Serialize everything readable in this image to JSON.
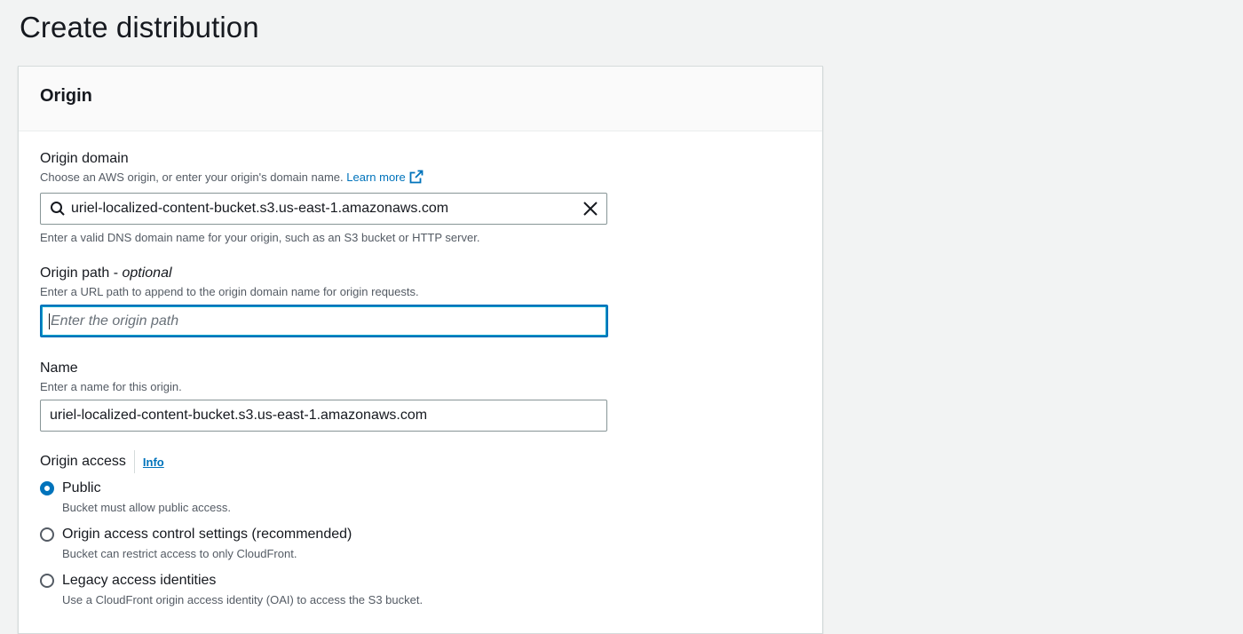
{
  "page": {
    "title": "Create distribution"
  },
  "origin_panel": {
    "header": "Origin",
    "origin_domain": {
      "label": "Origin domain",
      "description": "Choose an AWS origin, or enter your origin's domain name.",
      "learn_more": "Learn more",
      "value": "uriel-localized-content-bucket.s3.us-east-1.amazonaws.com",
      "hint": "Enter a valid DNS domain name for your origin, such as an S3 bucket or HTTP server."
    },
    "origin_path": {
      "label": "Origin path - ",
      "label_optional": "optional",
      "description": "Enter a URL path to append to the origin domain name for origin requests.",
      "placeholder": "Enter the origin path",
      "value": ""
    },
    "name": {
      "label": "Name",
      "description": "Enter a name for this origin.",
      "value": "uriel-localized-content-bucket.s3.us-east-1.amazonaws.com"
    },
    "origin_access": {
      "label": "Origin access",
      "info": "Info",
      "selected": "public",
      "options": [
        {
          "id": "public",
          "label": "Public",
          "description": "Bucket must allow public access."
        },
        {
          "id": "oac",
          "label": "Origin access control settings (recommended)",
          "description": "Bucket can restrict access to only CloudFront."
        },
        {
          "id": "legacy",
          "label": "Legacy access identities",
          "description": "Use a CloudFront origin access identity (OAI) to access the S3 bucket."
        }
      ]
    }
  },
  "colors": {
    "background": "#f2f3f3",
    "link": "#0073bb",
    "focus_border": "#0073bb",
    "text_primary": "#16191f",
    "text_secondary": "#545b64"
  }
}
